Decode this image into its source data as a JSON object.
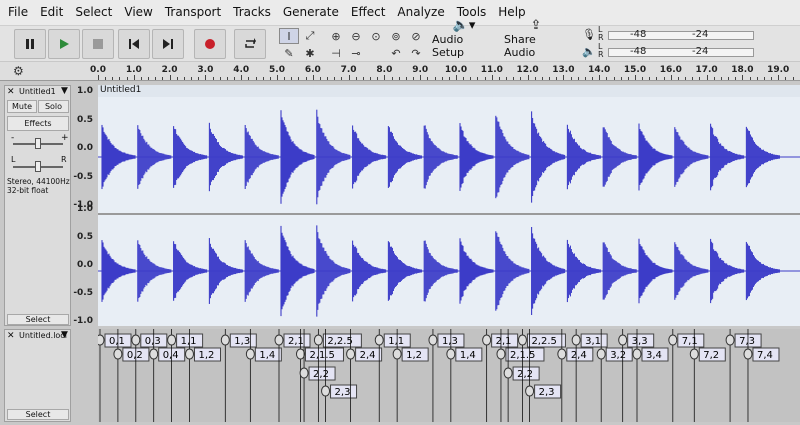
{
  "menus": [
    "File",
    "Edit",
    "Select",
    "View",
    "Transport",
    "Tracks",
    "Generate",
    "Effect",
    "Analyze",
    "Tools",
    "Help"
  ],
  "toolbar": {
    "audio_setup": "Audio Setup",
    "share_audio": "Share Audio",
    "meter_labels": [
      "-48",
      "-24"
    ],
    "record_meter_channels": [
      "L",
      "R"
    ],
    "play_meter_channels": [
      "L",
      "R"
    ]
  },
  "ruler": {
    "ticks": [
      "0.0",
      "1.0",
      "2.0",
      "3.0",
      "4.0",
      "5.0",
      "6.0",
      "7.0",
      "8.0",
      "9.0",
      "10.0",
      "11.0",
      "12.0",
      "13.0",
      "14.0",
      "15.0",
      "16.0",
      "17.0",
      "18.0",
      "19.0"
    ]
  },
  "audio_track": {
    "name": "Untitled1",
    "clip_name": "Untitled1",
    "mute": "Mute",
    "solo": "Solo",
    "effects": "Effects",
    "gain_minus": "-",
    "gain_plus": "+",
    "pan_left": "L",
    "pan_right": "R",
    "info_line1": "Stereo, 44100Hz",
    "info_line2": "32-bit float",
    "select": "Select",
    "axis_labels": [
      "1.0",
      "0.5",
      "0.0",
      "-0.5",
      "-1.0"
    ],
    "wave_color": "#3c3cc8"
  },
  "label_track": {
    "name": "Untitled.loci",
    "select": "Select",
    "labels": [
      {
        "text": "0,1",
        "time": 0.0,
        "row": 0
      },
      {
        "text": "0,2",
        "time": 0.5,
        "row": 1
      },
      {
        "text": "0,3",
        "time": 1.0,
        "row": 0
      },
      {
        "text": "0,4",
        "time": 1.5,
        "row": 1
      },
      {
        "text": "1,1",
        "time": 2.0,
        "row": 0
      },
      {
        "text": "1,2",
        "time": 2.5,
        "row": 1
      },
      {
        "text": "1,3",
        "time": 3.5,
        "row": 0
      },
      {
        "text": "1,4",
        "time": 4.2,
        "row": 1
      },
      {
        "text": "2,1",
        "time": 5.0,
        "row": 0
      },
      {
        "text": "2,1.5",
        "time": 5.6,
        "row": 1
      },
      {
        "text": "2,2",
        "time": 5.7,
        "row": 2
      },
      {
        "text": "2,2.5",
        "time": 6.1,
        "row": 0
      },
      {
        "text": "2,3",
        "time": 6.3,
        "row": 3
      },
      {
        "text": "2,4",
        "time": 7.0,
        "row": 1
      },
      {
        "text": "1,1",
        "time": 7.8,
        "row": 0
      },
      {
        "text": "1,2",
        "time": 8.3,
        "row": 1
      },
      {
        "text": "1,3",
        "time": 9.3,
        "row": 0
      },
      {
        "text": "1,4",
        "time": 9.8,
        "row": 1
      },
      {
        "text": "2,1",
        "time": 10.8,
        "row": 0
      },
      {
        "text": "2,1.5",
        "time": 11.2,
        "row": 1
      },
      {
        "text": "2,2",
        "time": 11.4,
        "row": 2
      },
      {
        "text": "2,2.5",
        "time": 11.8,
        "row": 0
      },
      {
        "text": "2,3",
        "time": 12.0,
        "row": 3
      },
      {
        "text": "2,4",
        "time": 12.9,
        "row": 1
      },
      {
        "text": "3,1",
        "time": 13.3,
        "row": 0
      },
      {
        "text": "3,2",
        "time": 14.0,
        "row": 1
      },
      {
        "text": "3,3",
        "time": 14.6,
        "row": 0
      },
      {
        "text": "3,4",
        "time": 15.0,
        "row": 1
      },
      {
        "text": "7,1",
        "time": 16.0,
        "row": 0
      },
      {
        "text": "7,2",
        "time": 16.6,
        "row": 1
      },
      {
        "text": "7,3",
        "time": 17.6,
        "row": 0
      },
      {
        "text": "7,4",
        "time": 18.1,
        "row": 1
      }
    ]
  }
}
